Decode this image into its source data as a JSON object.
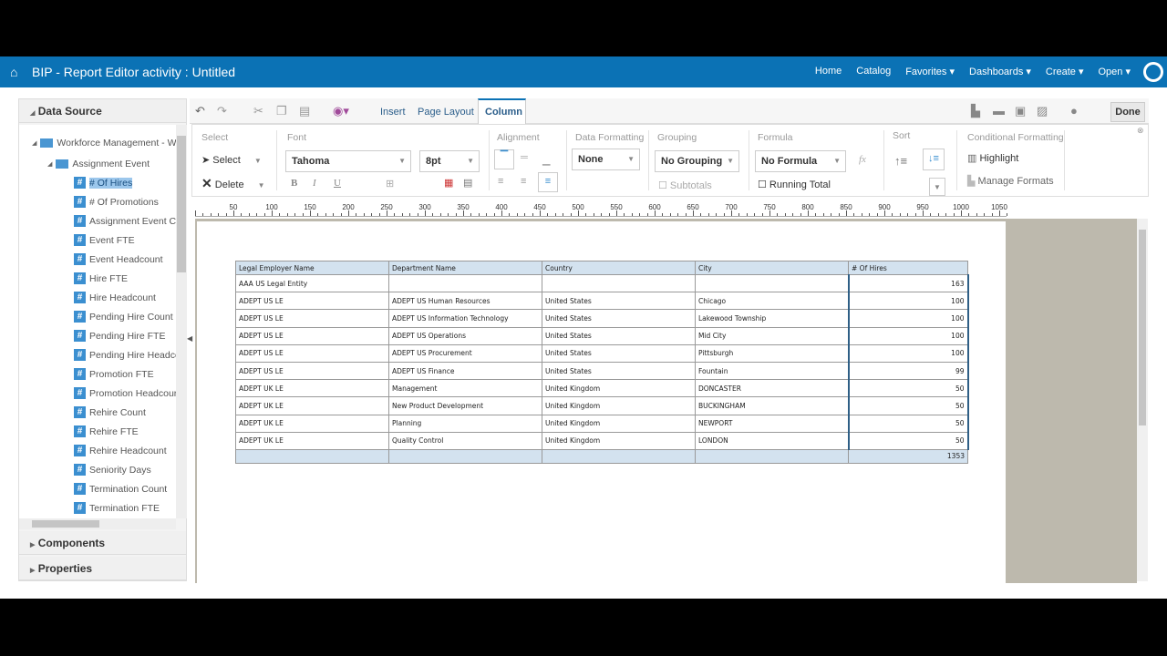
{
  "header": {
    "title": "BIP - Report Editor activity : Untitled",
    "nav": [
      "Home",
      "Catalog",
      "Favorites ▾",
      "Dashboards ▾",
      "Create ▾",
      "Open ▾"
    ]
  },
  "sidebar": {
    "data_source": "Data Source",
    "root": "Workforce Management - Wo",
    "folder": "Assignment Event",
    "items": [
      "# Of Hires",
      "# Of Promotions",
      "Assignment Event Co",
      "Event FTE",
      "Event Headcount",
      "Hire FTE",
      "Hire Headcount",
      "Pending Hire Count",
      "Pending Hire FTE",
      "Pending Hire Headco",
      "Promotion FTE",
      "Promotion Headcour",
      "Rehire Count",
      "Rehire FTE",
      "Rehire Headcount",
      "Seniority Days",
      "Termination Count",
      "Termination FTE"
    ],
    "selected": "# Of Hires",
    "components": "Components",
    "properties": "Properties"
  },
  "toolbar": {
    "tabs": [
      "Insert",
      "Page Layout",
      "Column"
    ],
    "active_tab": "Column",
    "done": "Done"
  },
  "ribbon": {
    "select_group": "Select",
    "select": "Select",
    "delete": "Delete",
    "font_group": "Font",
    "font": "Tahoma",
    "size": "8pt",
    "bold": "B",
    "italic": "I",
    "underline": "U",
    "alignment_group": "Alignment",
    "data_formatting_group": "Data Formatting",
    "data_formatting": "None",
    "grouping_group": "Grouping",
    "grouping": "No Grouping",
    "subtotals": "Subtotals",
    "formula_group": "Formula",
    "formula": "No Formula",
    "fx": "fx",
    "running_total": "Running Total",
    "sort_group": "Sort",
    "cond_group": "Conditional Formatting",
    "highlight": "Highlight",
    "manage_formats": "Manage Formats"
  },
  "ruler": [
    "50",
    "100",
    "150",
    "200",
    "250",
    "300",
    "350",
    "400",
    "450",
    "500",
    "550",
    "600",
    "650",
    "700",
    "750",
    "800",
    "850",
    "900",
    "950",
    "1000",
    "1050"
  ],
  "table": {
    "headers": [
      "Legal Employer Name",
      "Department Name",
      "Country",
      "City",
      "# Of Hires"
    ],
    "rows": [
      [
        "AAA US Legal Entity",
        "",
        "",
        "",
        "163"
      ],
      [
        "ADEPT US LE",
        "ADEPT US Human Resources",
        "United States",
        "Chicago",
        "100"
      ],
      [
        "ADEPT US LE",
        "ADEPT US Information Technology",
        "United States",
        "Lakewood Township",
        "100"
      ],
      [
        "ADEPT US LE",
        "ADEPT US Operations",
        "United States",
        "Mid City",
        "100"
      ],
      [
        "ADEPT US LE",
        "ADEPT US Procurement",
        "United States",
        "Pittsburgh",
        "100"
      ],
      [
        "ADEPT US LE",
        "ADEPT US Finance",
        "United States",
        "Fountain",
        "99"
      ],
      [
        "ADEPT UK LE",
        "Management",
        "United Kingdom",
        "DONCASTER",
        "50"
      ],
      [
        "ADEPT UK LE",
        "New Product Development",
        "United Kingdom",
        "BUCKINGHAM",
        "50"
      ],
      [
        "ADEPT UK LE",
        "Planning",
        "United Kingdom",
        "NEWPORT",
        "50"
      ],
      [
        "ADEPT UK LE",
        "Quality Control",
        "United Kingdom",
        "LONDON",
        "50"
      ]
    ],
    "total": "1353"
  },
  "colors": {
    "header_blue": "#0b72b5",
    "table_header": "#d3e2ef"
  }
}
